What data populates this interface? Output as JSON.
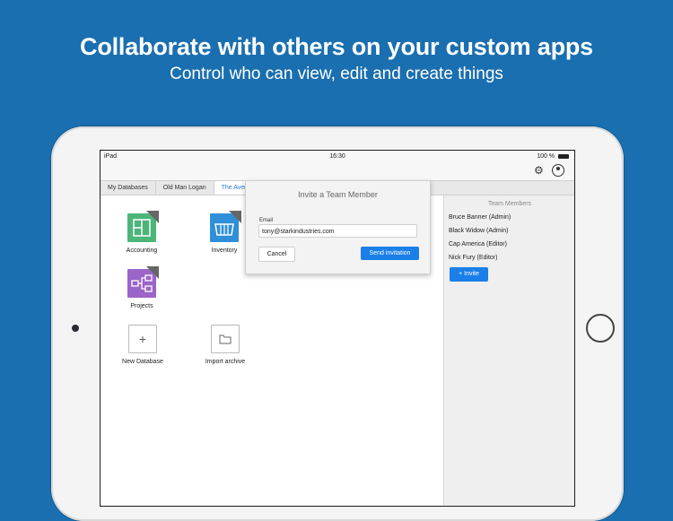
{
  "headline": "Collaborate with others on your custom apps",
  "subline": "Control who can view, edit and create things",
  "status": {
    "device": "iPad",
    "time": "16:30",
    "battery": "100 %"
  },
  "tabs": [
    "My Databases",
    "Old Man Logan",
    "The Aven"
  ],
  "databases": [
    {
      "label": "Accounting",
      "color": "#4cb57a",
      "icon": "accounting-icon"
    },
    {
      "label": "Inventory",
      "color": "#2f8fd8",
      "icon": "inventory-icon"
    },
    {
      "label": "Projects",
      "color": "#9b64c8",
      "icon": "projects-icon"
    }
  ],
  "actions": [
    {
      "label": "New Database",
      "icon": "plus-icon"
    },
    {
      "label": "Import archive",
      "icon": "folder-icon"
    }
  ],
  "team_panel": {
    "title": "Team Members",
    "members": [
      "Bruce Banner (Admin)",
      "Black Widow (Admin)",
      "Cap America (Editor)",
      "Nick Fury (Editor)"
    ],
    "invite_label": "+ Invite"
  },
  "modal": {
    "title": "Invite a Team Member",
    "email_label": "Email",
    "email_value": "tony@starkindustries.com",
    "cancel_label": "Cancel",
    "send_label": "Send invitation"
  }
}
